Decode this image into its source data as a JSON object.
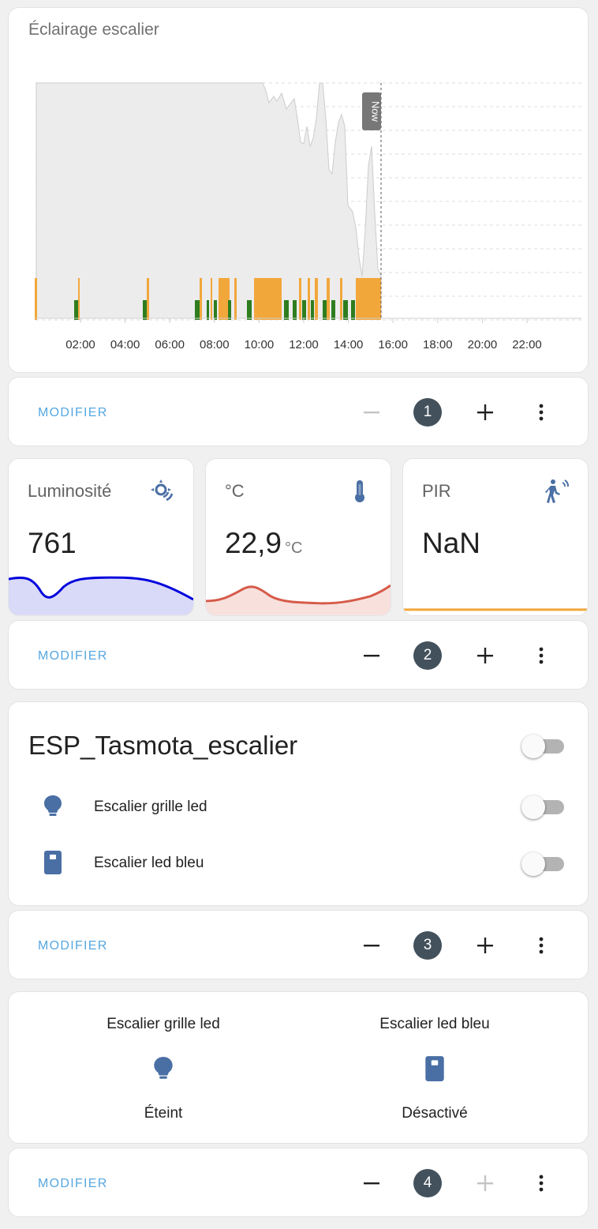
{
  "history_card": {
    "title": "Éclairage escalier",
    "now_label": "Now",
    "x_ticks": [
      "02:00",
      "04:00",
      "06:00",
      "08:00",
      "10:00",
      "12:00",
      "14:00",
      "16:00",
      "18:00",
      "20:00",
      "22:00"
    ],
    "colors": {
      "area": "#ececec",
      "area_line": "#cccccc",
      "on": "#f2a73b",
      "green": "#2e7d1f"
    }
  },
  "sections": [
    {
      "edit_label": "MODIFIER",
      "index": "1"
    },
    {
      "edit_label": "MODIFIER",
      "index": "2"
    },
    {
      "edit_label": "MODIFIER",
      "index": "3"
    },
    {
      "edit_label": "MODIFIER",
      "index": "4"
    }
  ],
  "sensors": [
    {
      "name": "Luminosité",
      "value": "761",
      "unit": "",
      "icon": "brightness-auto-icon",
      "color": "#0000dd",
      "fill": "#d9d9f8"
    },
    {
      "name": "°C",
      "value": "22,9",
      "unit": "°C",
      "icon": "thermometer-icon",
      "color": "#d65b4a",
      "fill": "#f8e0dd"
    },
    {
      "name": "PIR",
      "value": "NaN",
      "unit": "",
      "icon": "motion-sensor-icon",
      "color": "#f2a73b",
      "fill": "#ffffff"
    }
  ],
  "entities_card": {
    "title": "ESP_Tasmota_escalier",
    "rows": [
      {
        "name": "Escalier grille led",
        "icon": "lightbulb-icon"
      },
      {
        "name": "Escalier led bleu",
        "icon": "switch-icon"
      }
    ]
  },
  "glance_card": {
    "items": [
      {
        "name": "Escalier grille led",
        "state": "Éteint",
        "icon": "lightbulb-icon"
      },
      {
        "name": "Escalier led bleu",
        "state": "Désactivé",
        "icon": "switch-icon"
      }
    ]
  },
  "colors": {
    "accent": "#56a7e0",
    "icon_blue": "#4a6fa5",
    "badge": "#43515c"
  }
}
